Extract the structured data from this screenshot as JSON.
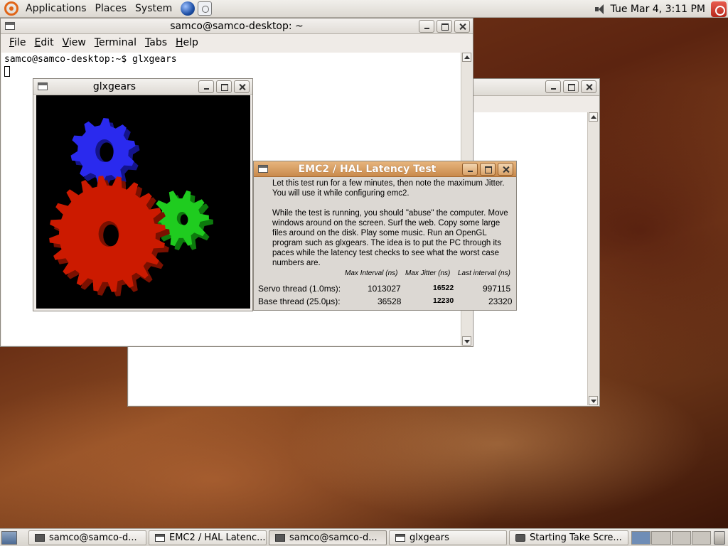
{
  "top_panel": {
    "menus": [
      "Applications",
      "Places",
      "System"
    ],
    "clock": "Tue Mar  4,  3:11 PM"
  },
  "terminal_window": {
    "title": "samco@samco-desktop: ~",
    "menu": [
      "File",
      "Edit",
      "View",
      "Terminal",
      "Tabs",
      "Help"
    ],
    "lines": [
      "samco@samco-desktop:~$ glxgears"
    ]
  },
  "glxgears_window": {
    "title": "glxgears",
    "gear_colors": {
      "red": "#cc1a00",
      "green": "#1fcc1f",
      "blue": "#2a2aee"
    }
  },
  "latency_window": {
    "title": "EMC2 / HAL Latency Test",
    "para1": "Let this test run for a few minutes, then note the maximum Jitter.  You will use it while configuring emc2.",
    "para2": "While the test is running, you should \"abuse\" the computer. Move windows around on the screen. Surf the web. Copy some large files around on the disk. Play some music. Run an OpenGL program such as glxgears. The idea is to put the PC through its paces while the latency test checks to see what the worst case numbers are.",
    "headers": {
      "max_interval": "Max Interval (ns)",
      "max_jitter": "Max Jitter (ns)",
      "last_interval": "Last interval (ns)"
    },
    "rows": [
      {
        "label": "Servo thread (1.0ms):",
        "max_interval": "1013027",
        "max_jitter": "16522",
        "last_interval": "997115"
      },
      {
        "label": "Base thread (25.0µs):",
        "max_interval": "36528",
        "max_jitter": "12230",
        "last_interval": "23320"
      }
    ]
  },
  "taskbar": {
    "tasks": [
      {
        "label": "samco@samco-d...",
        "icon": "terminal-icon"
      },
      {
        "label": "EMC2 / HAL Latenc...",
        "icon": "window-icon"
      },
      {
        "label": "samco@samco-d...",
        "icon": "terminal-icon"
      },
      {
        "label": "glxgears",
        "icon": "window-icon"
      },
      {
        "label": "Starting Take Scre...",
        "icon": "camera-icon"
      }
    ]
  }
}
